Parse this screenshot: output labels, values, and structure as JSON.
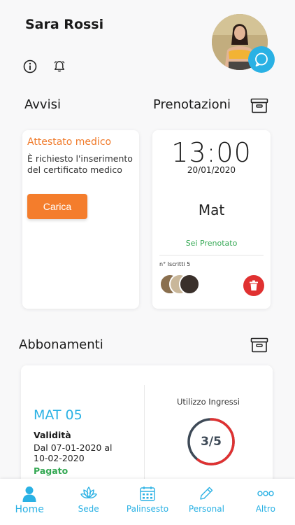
{
  "user": {
    "name": "Sara Rossi"
  },
  "header_icons": {
    "info": "info-icon",
    "notifications": "bell-icon",
    "chat": "chat-icon"
  },
  "avvisi": {
    "title": "Avvisi",
    "card_title": "Attestato medico",
    "card_text": "È richiesto l'inserimento del certificato medico",
    "button": "Carica"
  },
  "prenotazioni": {
    "title": "Prenotazioni",
    "time": "13:00",
    "date": "20/01/2020",
    "course": "Mat",
    "status": "Sei Prenotato",
    "enrolled": "n° Iscritti 5"
  },
  "abbonamenti": {
    "title": "Abbonamenti",
    "name": "MAT 05",
    "validity_label": "Validità",
    "validity_range": "Dal 07-01-2020 al 10-02-2020",
    "payment_status": "Pagato",
    "usage_label": "Utilizzo Ingressi",
    "usage_value": "3/5",
    "usage_fraction": 0.6
  },
  "nav": [
    {
      "label": "Home",
      "icon": "user-icon"
    },
    {
      "label": "Sede",
      "icon": "lotus-icon"
    },
    {
      "label": "Palinsesto",
      "icon": "calendar-icon"
    },
    {
      "label": "Personal",
      "icon": "pencil-icon"
    },
    {
      "label": "Altro",
      "icon": "more-icon"
    }
  ],
  "colors": {
    "accent": "#2ab1e4",
    "orange": "#f47d2c",
    "green": "#34a853",
    "red": "#e03131",
    "gauge_track": "#3e4a57"
  }
}
